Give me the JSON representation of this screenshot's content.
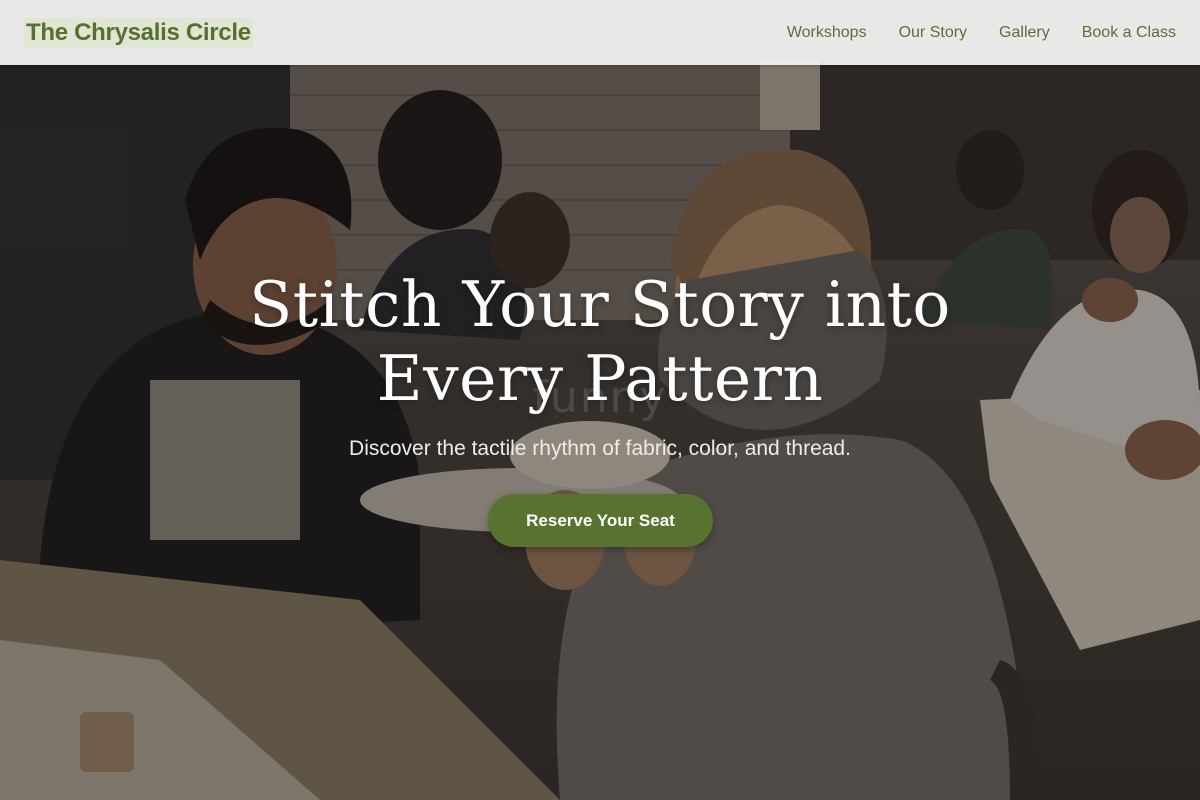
{
  "brand": {
    "name": "The Chrysalis Circle"
  },
  "nav": {
    "items": [
      {
        "label": "Workshops"
      },
      {
        "label": "Our Story"
      },
      {
        "label": "Gallery"
      },
      {
        "label": "Book a Class"
      }
    ]
  },
  "hero": {
    "headline_line1": "Stitch Your Story into",
    "headline_line2": "Every Pattern",
    "subheadline": "Discover the tactile rhythm of fabric, color, and thread.",
    "cta_label": "Reserve Your Seat",
    "watermark": "funny"
  },
  "colors": {
    "accent": "#58722f",
    "nav_text": "#5b6e3a",
    "header_bg": "#f6f5f3"
  }
}
